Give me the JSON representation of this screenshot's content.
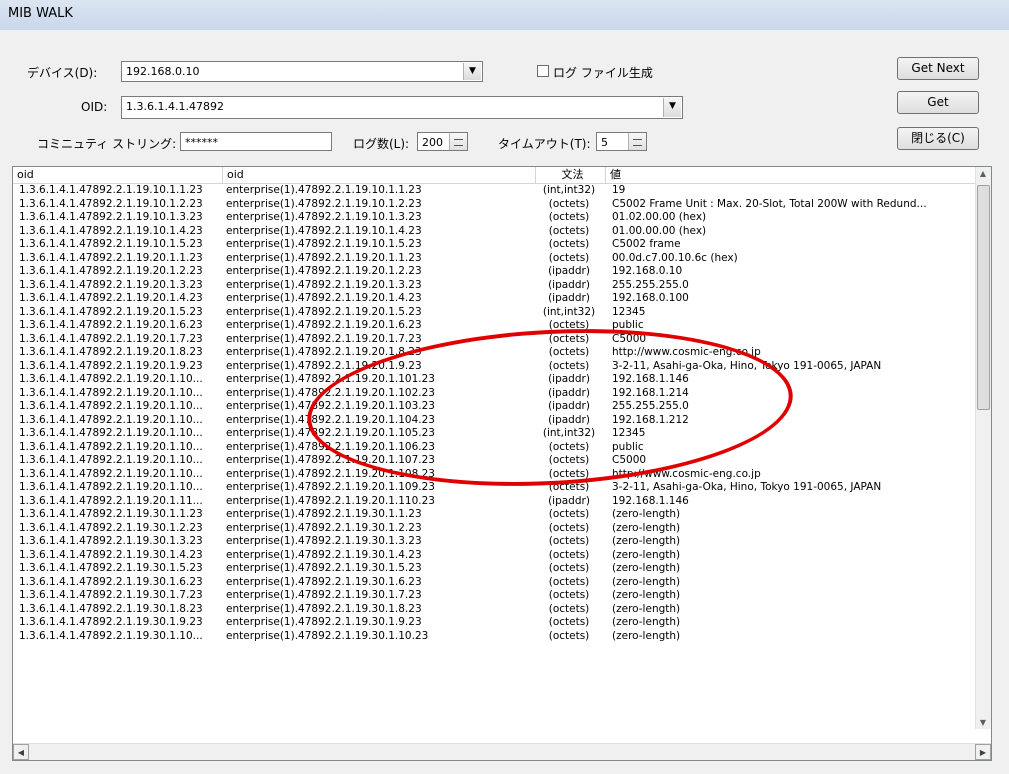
{
  "window": {
    "title": "MIB WALK"
  },
  "form": {
    "device_label": "デバイス(D):",
    "device_value": "192.168.0.10",
    "log_checkbox_label": "ログ ファイル生成",
    "oid_label": "OID:",
    "oid_value": "1.3.6.1.4.1.47892",
    "community_label": "コミニュティ ストリング:",
    "community_value": "******",
    "log_count_label": "ログ数(L):",
    "log_count_value": "200",
    "timeout_label": "タイムアウト(T):",
    "timeout_value": "5"
  },
  "buttons": {
    "get_next": "Get Next",
    "get": "Get",
    "close": "閉じる(C)"
  },
  "table": {
    "headers": [
      "oid",
      "oid",
      "文法",
      "値"
    ],
    "rows": [
      [
        "1.3.6.1.4.1.47892.2.1.19.10.1.1.23",
        "enterprise(1).47892.2.1.19.10.1.1.23",
        "(int,int32)",
        "19"
      ],
      [
        "1.3.6.1.4.1.47892.2.1.19.10.1.2.23",
        "enterprise(1).47892.2.1.19.10.1.2.23",
        "(octets)",
        "C5002 Frame Unit : Max. 20-Slot, Total 200W with Redund..."
      ],
      [
        "1.3.6.1.4.1.47892.2.1.19.10.1.3.23",
        "enterprise(1).47892.2.1.19.10.1.3.23",
        "(octets)",
        "01.02.00.00 (hex)"
      ],
      [
        "1.3.6.1.4.1.47892.2.1.19.10.1.4.23",
        "enterprise(1).47892.2.1.19.10.1.4.23",
        "(octets)",
        "01.00.00.00 (hex)"
      ],
      [
        "1.3.6.1.4.1.47892.2.1.19.10.1.5.23",
        "enterprise(1).47892.2.1.19.10.1.5.23",
        "(octets)",
        "C5002 frame"
      ],
      [
        "1.3.6.1.4.1.47892.2.1.19.20.1.1.23",
        "enterprise(1).47892.2.1.19.20.1.1.23",
        "(octets)",
        "00.0d.c7.00.10.6c (hex)"
      ],
      [
        "1.3.6.1.4.1.47892.2.1.19.20.1.2.23",
        "enterprise(1).47892.2.1.19.20.1.2.23",
        "(ipaddr)",
        "192.168.0.10"
      ],
      [
        "1.3.6.1.4.1.47892.2.1.19.20.1.3.23",
        "enterprise(1).47892.2.1.19.20.1.3.23",
        "(ipaddr)",
        "255.255.255.0"
      ],
      [
        "1.3.6.1.4.1.47892.2.1.19.20.1.4.23",
        "enterprise(1).47892.2.1.19.20.1.4.23",
        "(ipaddr)",
        "192.168.0.100"
      ],
      [
        "1.3.6.1.4.1.47892.2.1.19.20.1.5.23",
        "enterprise(1).47892.2.1.19.20.1.5.23",
        "(int,int32)",
        "12345"
      ],
      [
        "1.3.6.1.4.1.47892.2.1.19.20.1.6.23",
        "enterprise(1).47892.2.1.19.20.1.6.23",
        "(octets)",
        "public"
      ],
      [
        "1.3.6.1.4.1.47892.2.1.19.20.1.7.23",
        "enterprise(1).47892.2.1.19.20.1.7.23",
        "(octets)",
        "C5000"
      ],
      [
        "1.3.6.1.4.1.47892.2.1.19.20.1.8.23",
        "enterprise(1).47892.2.1.19.20.1.8.23",
        "(octets)",
        "http://www.cosmic-eng.co.jp"
      ],
      [
        "1.3.6.1.4.1.47892.2.1.19.20.1.9.23",
        "enterprise(1).47892.2.1.19.20.1.9.23",
        "(octets)",
        "3-2-11, Asahi-ga-Oka, Hino, Tokyo 191-0065, JAPAN"
      ],
      [
        "1.3.6.1.4.1.47892.2.1.19.20.1.10...",
        "enterprise(1).47892.2.1.19.20.1.101.23",
        "(ipaddr)",
        "192.168.1.146"
      ],
      [
        "1.3.6.1.4.1.47892.2.1.19.20.1.10...",
        "enterprise(1).47892.2.1.19.20.1.102.23",
        "(ipaddr)",
        "192.168.1.214"
      ],
      [
        "1.3.6.1.4.1.47892.2.1.19.20.1.10...",
        "enterprise(1).47892.2.1.19.20.1.103.23",
        "(ipaddr)",
        "255.255.255.0"
      ],
      [
        "1.3.6.1.4.1.47892.2.1.19.20.1.10...",
        "enterprise(1).47892.2.1.19.20.1.104.23",
        "(ipaddr)",
        "192.168.1.212"
      ],
      [
        "1.3.6.1.4.1.47892.2.1.19.20.1.10...",
        "enterprise(1).47892.2.1.19.20.1.105.23",
        "(int,int32)",
        "12345"
      ],
      [
        "1.3.6.1.4.1.47892.2.1.19.20.1.10...",
        "enterprise(1).47892.2.1.19.20.1.106.23",
        "(octets)",
        "public"
      ],
      [
        "1.3.6.1.4.1.47892.2.1.19.20.1.10...",
        "enterprise(1).47892.2.1.19.20.1.107.23",
        "(octets)",
        "C5000"
      ],
      [
        "1.3.6.1.4.1.47892.2.1.19.20.1.10...",
        "enterprise(1).47892.2.1.19.20.1.108.23",
        "(octets)",
        "http://www.cosmic-eng.co.jp"
      ],
      [
        "1.3.6.1.4.1.47892.2.1.19.20.1.10...",
        "enterprise(1).47892.2.1.19.20.1.109.23",
        "(octets)",
        "3-2-11, Asahi-ga-Oka, Hino, Tokyo 191-0065, JAPAN"
      ],
      [
        "1.3.6.1.4.1.47892.2.1.19.20.1.11...",
        "enterprise(1).47892.2.1.19.20.1.110.23",
        "(ipaddr)",
        "192.168.1.146"
      ],
      [
        "1.3.6.1.4.1.47892.2.1.19.30.1.1.23",
        "enterprise(1).47892.2.1.19.30.1.1.23",
        "(octets)",
        "(zero-length)"
      ],
      [
        "1.3.6.1.4.1.47892.2.1.19.30.1.2.23",
        "enterprise(1).47892.2.1.19.30.1.2.23",
        "(octets)",
        "(zero-length)"
      ],
      [
        "1.3.6.1.4.1.47892.2.1.19.30.1.3.23",
        "enterprise(1).47892.2.1.19.30.1.3.23",
        "(octets)",
        "(zero-length)"
      ],
      [
        "1.3.6.1.4.1.47892.2.1.19.30.1.4.23",
        "enterprise(1).47892.2.1.19.30.1.4.23",
        "(octets)",
        "(zero-length)"
      ],
      [
        "1.3.6.1.4.1.47892.2.1.19.30.1.5.23",
        "enterprise(1).47892.2.1.19.30.1.5.23",
        "(octets)",
        "(zero-length)"
      ],
      [
        "1.3.6.1.4.1.47892.2.1.19.30.1.6.23",
        "enterprise(1).47892.2.1.19.30.1.6.23",
        "(octets)",
        "(zero-length)"
      ],
      [
        "1.3.6.1.4.1.47892.2.1.19.30.1.7.23",
        "enterprise(1).47892.2.1.19.30.1.7.23",
        "(octets)",
        "(zero-length)"
      ],
      [
        "1.3.6.1.4.1.47892.2.1.19.30.1.8.23",
        "enterprise(1).47892.2.1.19.30.1.8.23",
        "(octets)",
        "(zero-length)"
      ],
      [
        "1.3.6.1.4.1.47892.2.1.19.30.1.9.23",
        "enterprise(1).47892.2.1.19.30.1.9.23",
        "(octets)",
        "(zero-length)"
      ],
      [
        "1.3.6.1.4.1.47892.2.1.19.30.1.10...",
        "enterprise(1).47892.2.1.19.30.1.10.23",
        "(octets)",
        "(zero-length)"
      ]
    ]
  },
  "colors": {
    "annotation": "#e00000"
  }
}
